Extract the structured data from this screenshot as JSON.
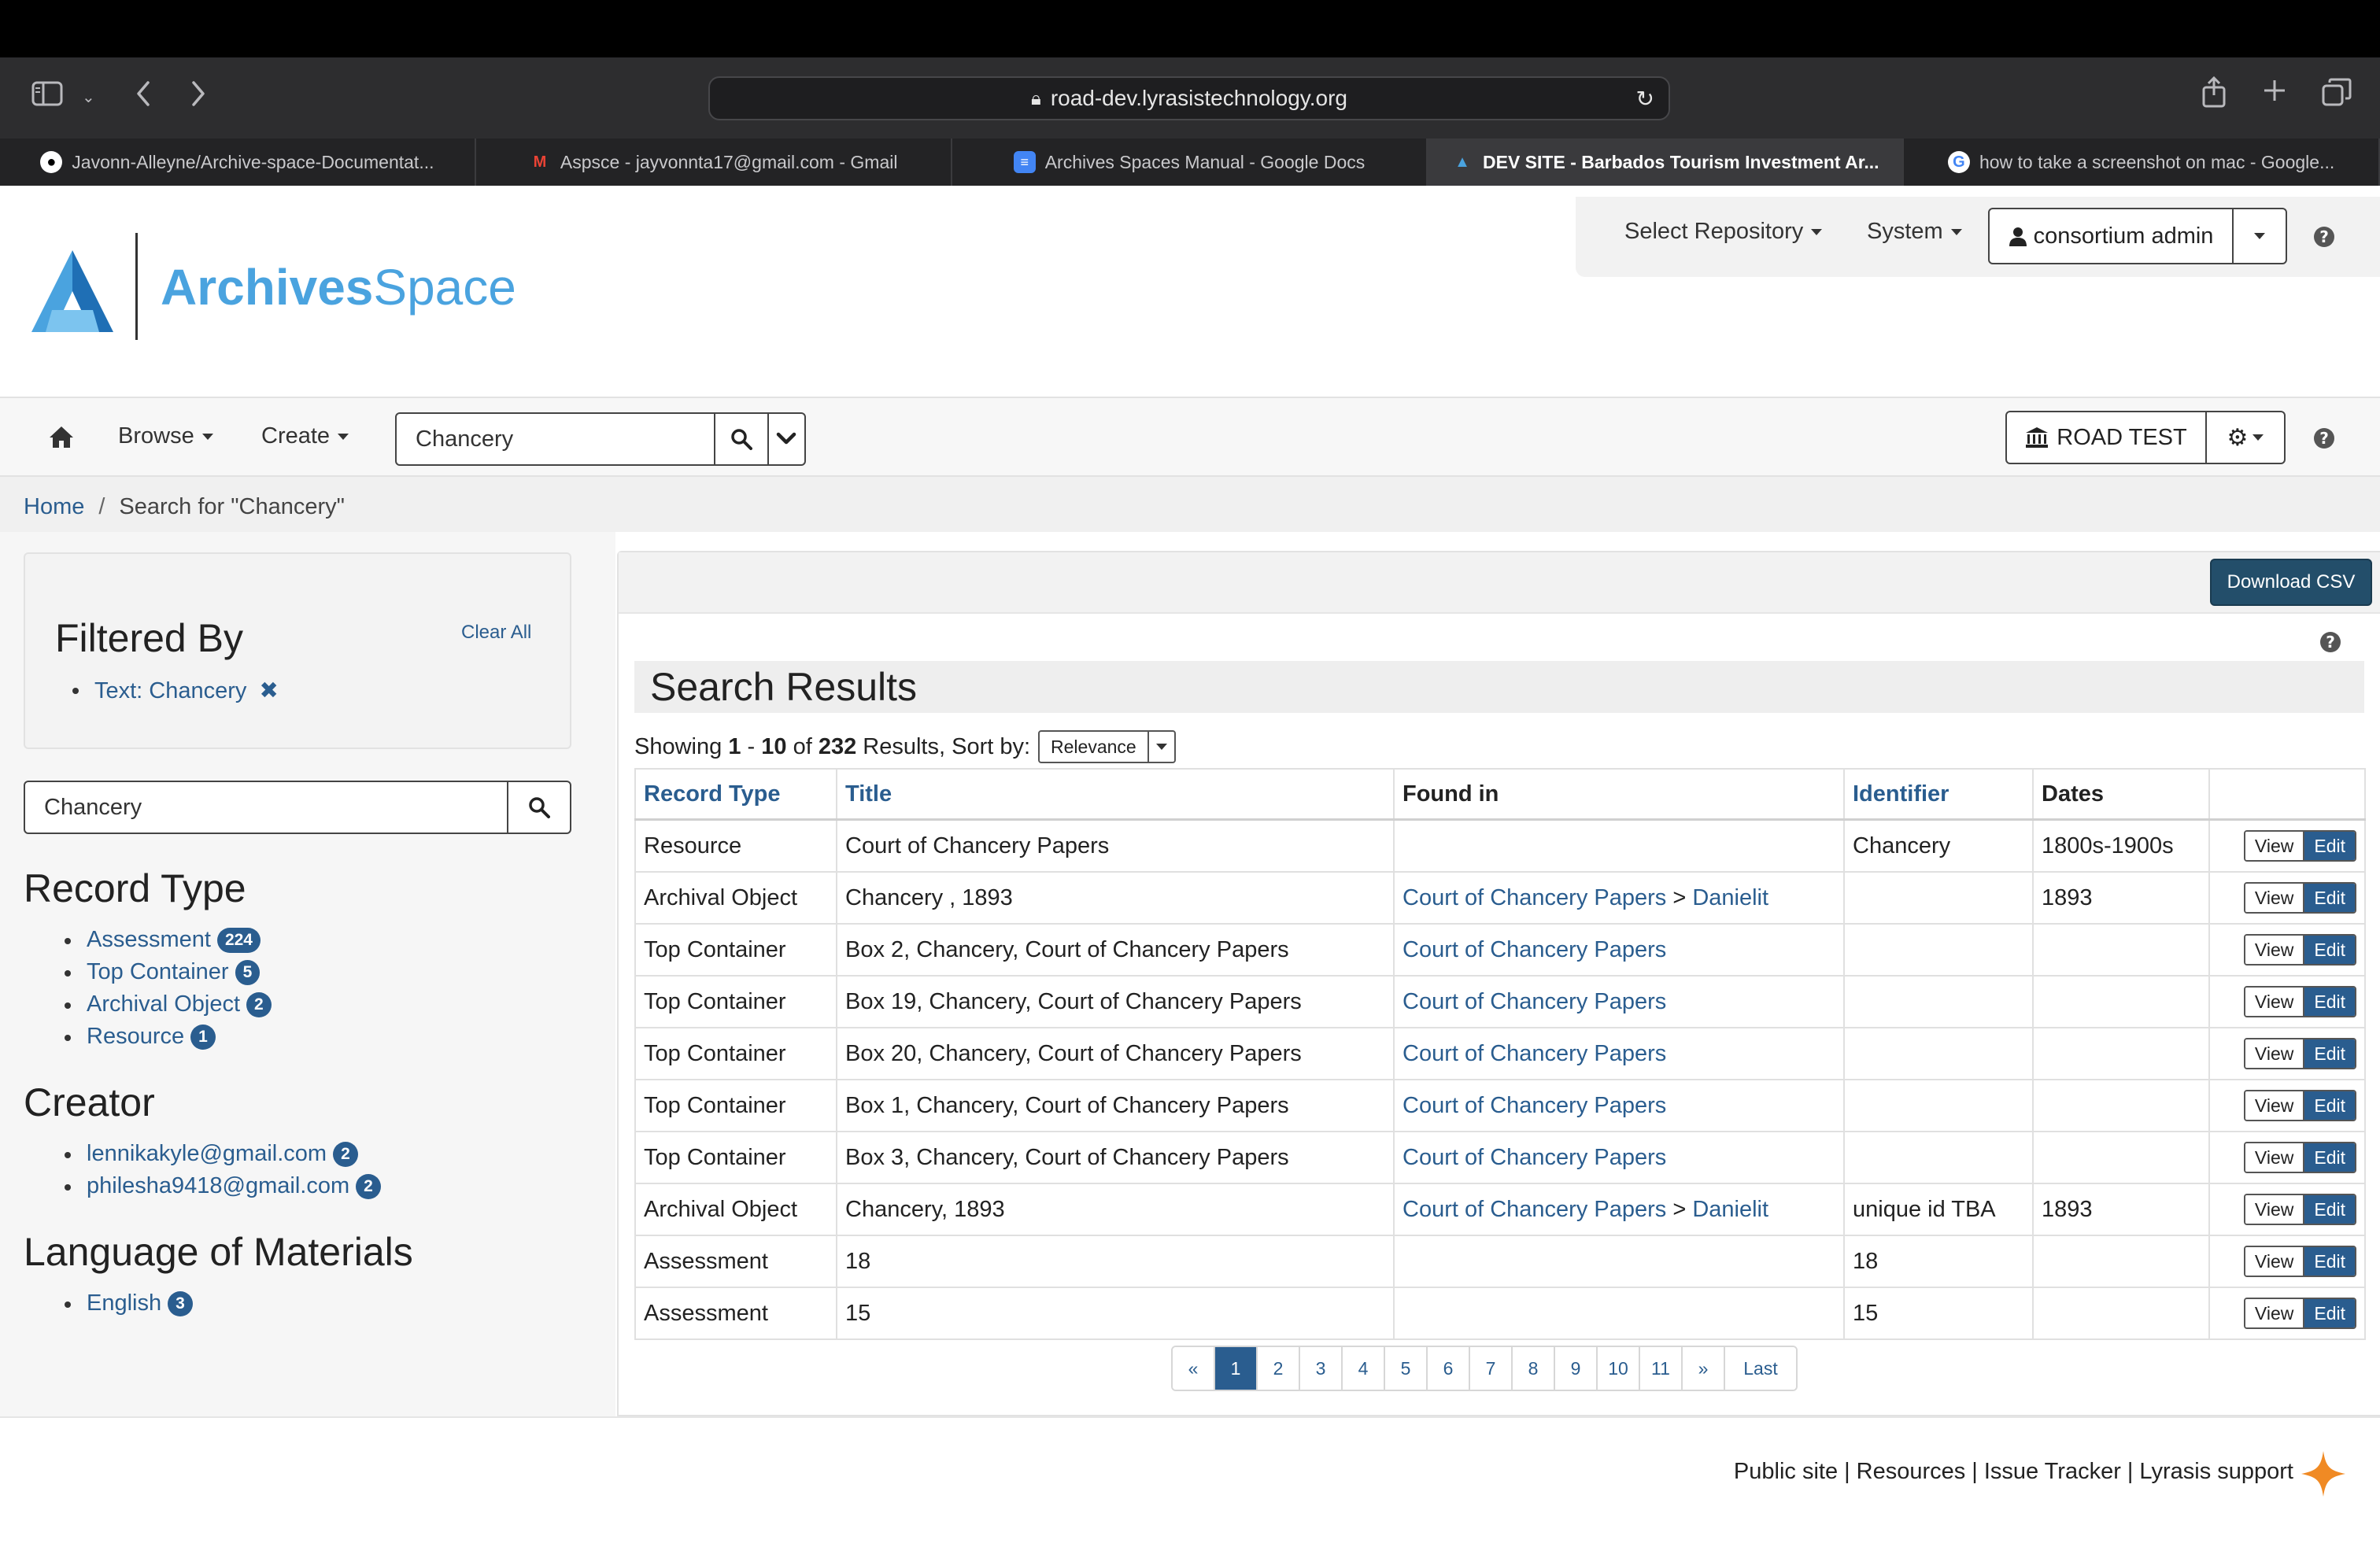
{
  "browser": {
    "url": "road-dev.lyrasistechnology.org",
    "tabs": [
      {
        "title": "Javonn-Alleyne/Archive-space-Documentat...",
        "icon": "github-icon",
        "active": false
      },
      {
        "title": "Aspsce - jayvonnta17@gmail.com - Gmail",
        "icon": "gmail-icon",
        "active": false
      },
      {
        "title": "Archives Spaces Manual - Google Docs",
        "icon": "google-docs-icon",
        "active": false
      },
      {
        "title": "DEV SITE - Barbados Tourism Investment Ar...",
        "icon": "archivesspace-icon",
        "active": true
      },
      {
        "title": "how to take a screenshot on mac - Google...",
        "icon": "google-icon",
        "active": false
      }
    ]
  },
  "app": {
    "logo_text_bold": "Archives",
    "logo_text_light": "Space",
    "brand_color": "#4aa3df",
    "accent_color": "#2a5d8f"
  },
  "user_menu": {
    "select_repository": "Select Repository",
    "system": "System",
    "user": "consortium admin"
  },
  "nav": {
    "browse": "Browse",
    "create": "Create",
    "search_value": "Chancery",
    "repository": "ROAD TEST"
  },
  "breadcrumb": {
    "home": "Home",
    "current": "Search for \"Chancery\""
  },
  "sidebar": {
    "filtered_by_title": "Filtered By",
    "clear_all": "Clear All",
    "active_filter": "Text: Chancery",
    "search_value": "Chancery",
    "facets": [
      {
        "title": "Record Type",
        "items": [
          {
            "label": "Assessment",
            "count": "224"
          },
          {
            "label": "Top Container",
            "count": "5"
          },
          {
            "label": "Archival Object",
            "count": "2"
          },
          {
            "label": "Resource",
            "count": "1"
          }
        ]
      },
      {
        "title": "Creator",
        "items": [
          {
            "label": "lennikakyle@gmail.com",
            "count": "2"
          },
          {
            "label": "philesha9418@gmail.com",
            "count": "2"
          }
        ]
      },
      {
        "title": "Language of Materials",
        "items": [
          {
            "label": "English",
            "count": "3"
          }
        ]
      }
    ]
  },
  "results": {
    "download_csv": "Download CSV",
    "title": "Search Results",
    "showing_prefix": "Showing",
    "range_start": "1",
    "range_sep": "-",
    "range_end": "10",
    "of": "of",
    "total": "232",
    "suffix": "Results, Sort by:",
    "sort_value": "Relevance",
    "columns": [
      "Record Type",
      "Title",
      "Found in",
      "Identifier",
      "Dates",
      ""
    ],
    "view_label": "View",
    "edit_label": "Edit",
    "rows": [
      {
        "type": "Resource",
        "title": "Court of Chancery Papers",
        "found_in": "",
        "found_in_child": "",
        "identifier": "Chancery",
        "dates": "1800s-1900s"
      },
      {
        "type": "Archival Object",
        "title": "Chancery , 1893",
        "found_in": "Court of Chancery Papers",
        "found_in_child": "Danielit",
        "identifier": "",
        "dates": "1893"
      },
      {
        "type": "Top Container",
        "title": "Box 2, Chancery, Court of Chancery Papers",
        "found_in": "Court of Chancery Papers",
        "found_in_child": "",
        "identifier": "",
        "dates": ""
      },
      {
        "type": "Top Container",
        "title": "Box 19, Chancery, Court of Chancery Papers",
        "found_in": "Court of Chancery Papers",
        "found_in_child": "",
        "identifier": "",
        "dates": ""
      },
      {
        "type": "Top Container",
        "title": "Box 20, Chancery, Court of Chancery Papers",
        "found_in": "Court of Chancery Papers",
        "found_in_child": "",
        "identifier": "",
        "dates": ""
      },
      {
        "type": "Top Container",
        "title": "Box 1, Chancery, Court of Chancery Papers",
        "found_in": "Court of Chancery Papers",
        "found_in_child": "",
        "identifier": "",
        "dates": ""
      },
      {
        "type": "Top Container",
        "title": "Box 3, Chancery, Court of Chancery Papers",
        "found_in": "Court of Chancery Papers",
        "found_in_child": "",
        "identifier": "",
        "dates": ""
      },
      {
        "type": "Archival Object",
        "title": "Chancery, 1893",
        "found_in": "Court of Chancery Papers",
        "found_in_child": "Danielit",
        "identifier": "unique id TBA",
        "dates": "1893"
      },
      {
        "type": "Assessment",
        "title": "18",
        "found_in": "",
        "found_in_child": "",
        "identifier": "18",
        "dates": ""
      },
      {
        "type": "Assessment",
        "title": "15",
        "found_in": "",
        "found_in_child": "",
        "identifier": "15",
        "dates": ""
      }
    ],
    "pagination": [
      "«",
      "1",
      "2",
      "3",
      "4",
      "5",
      "6",
      "7",
      "8",
      "9",
      "10",
      "11",
      "»",
      "Last"
    ],
    "current_page": "1"
  },
  "footer": {
    "links": [
      "Public site",
      "Resources",
      "Issue Tracker",
      "Lyrasis support"
    ],
    "star_color": "#f08a24"
  }
}
